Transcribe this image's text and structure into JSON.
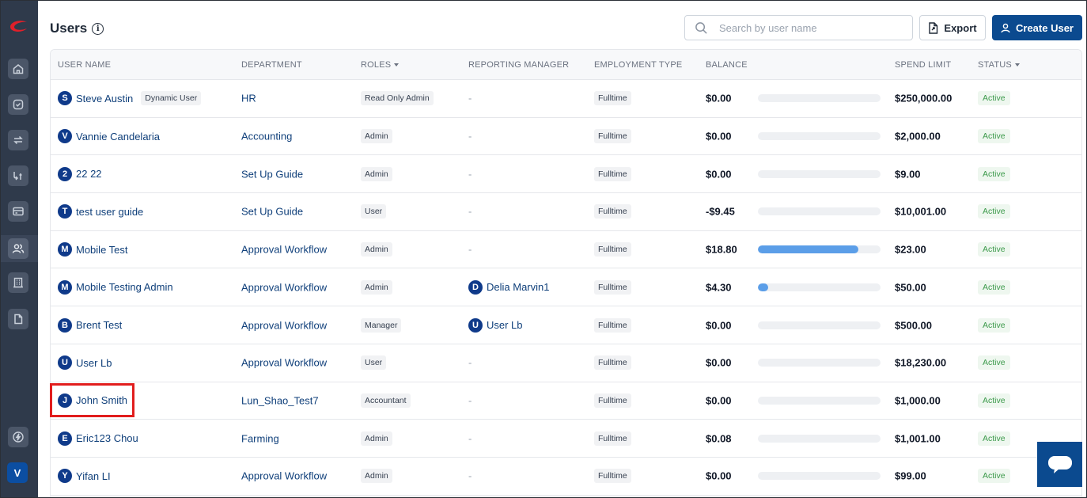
{
  "header": {
    "title": "Users",
    "search_placeholder": "Search by user name",
    "export_label": "Export",
    "create_label": "Create User"
  },
  "sidebar": {
    "items": [
      "home-icon",
      "check-circle-icon",
      "transfer-icon",
      "reimburse-icon",
      "card-icon",
      "users-icon",
      "building-icon",
      "document-icon",
      "lightning-icon"
    ],
    "avatar_initial": "V"
  },
  "table": {
    "headers": {
      "user_name": "USER NAME",
      "department": "DEPARTMENT",
      "roles": "ROLES",
      "reporting_manager": "REPORTING MANAGER",
      "employment_type": "EMPLOYMENT TYPE",
      "balance": "BALANCE",
      "spend_limit": "SPEND LIMIT",
      "status": "STATUS"
    },
    "rows": [
      {
        "initial": "S",
        "name": "Steve Austin",
        "tag": "Dynamic User",
        "department": "HR",
        "role": "Read Only Admin",
        "manager_initial": "",
        "manager": "-",
        "employment": "Fulltime",
        "balance": "$0.00",
        "usage": 0,
        "spend_limit": "$250,000.00",
        "status": "Active"
      },
      {
        "initial": "V",
        "name": "Vannie Candelaria",
        "tag": "",
        "department": "Accounting",
        "role": "Admin",
        "manager_initial": "",
        "manager": "-",
        "employment": "Fulltime",
        "balance": "$0.00",
        "usage": 0,
        "spend_limit": "$2,000.00",
        "status": "Active"
      },
      {
        "initial": "2",
        "name": "22 22",
        "tag": "",
        "department": "Set Up Guide",
        "role": "Admin",
        "manager_initial": "",
        "manager": "-",
        "employment": "Fulltime",
        "balance": "$0.00",
        "usage": 0,
        "spend_limit": "$9.00",
        "status": "Active"
      },
      {
        "initial": "T",
        "name": "test user guide",
        "tag": "",
        "department": "Set Up Guide",
        "role": "User",
        "manager_initial": "",
        "manager": "-",
        "employment": "Fulltime",
        "balance": "-$9.45",
        "usage": 0,
        "spend_limit": "$10,001.00",
        "status": "Active"
      },
      {
        "initial": "M",
        "name": "Mobile Test",
        "tag": "",
        "department": "Approval Workflow",
        "role": "Admin",
        "manager_initial": "",
        "manager": "-",
        "employment": "Fulltime",
        "balance": "$18.80",
        "usage": 0.82,
        "spend_limit": "$23.00",
        "status": "Active"
      },
      {
        "initial": "M",
        "name": "Mobile Testing Admin",
        "tag": "",
        "department": "Approval Workflow",
        "role": "Admin",
        "manager_initial": "D",
        "manager": "Delia Marvin1",
        "employment": "Fulltime",
        "balance": "$4.30",
        "usage": 0.086,
        "spend_limit": "$50.00",
        "status": "Active"
      },
      {
        "initial": "B",
        "name": "Brent Test",
        "tag": "",
        "department": "Approval Workflow",
        "role": "Manager",
        "manager_initial": "U",
        "manager": "User Lb",
        "employment": "Fulltime",
        "balance": "$0.00",
        "usage": 0,
        "spend_limit": "$500.00",
        "status": "Active"
      },
      {
        "initial": "U",
        "name": "User Lb",
        "tag": "",
        "department": "Approval Workflow",
        "role": "User",
        "manager_initial": "",
        "manager": "-",
        "employment": "Fulltime",
        "balance": "$0.00",
        "usage": 0,
        "spend_limit": "$18,230.00",
        "status": "Active"
      },
      {
        "initial": "J",
        "name": "John Smith",
        "tag": "",
        "department": "Lun_Shao_Test7",
        "role": "Accountant",
        "manager_initial": "",
        "manager": "-",
        "employment": "Fulltime",
        "balance": "$0.00",
        "usage": 0,
        "spend_limit": "$1,000.00",
        "status": "Active"
      },
      {
        "initial": "E",
        "name": "Eric123 Chou",
        "tag": "",
        "department": "Farming",
        "role": "Admin",
        "manager_initial": "",
        "manager": "-",
        "employment": "Fulltime",
        "balance": "$0.08",
        "usage": 0,
        "spend_limit": "$1,001.00",
        "status": "Active"
      },
      {
        "initial": "Y",
        "name": "Yifan LI",
        "tag": "",
        "department": "Approval Workflow",
        "role": "Admin",
        "manager_initial": "",
        "manager": "-",
        "employment": "Fulltime",
        "balance": "$0.00",
        "usage": 0,
        "spend_limit": "$99.00",
        "status": "Active"
      }
    ]
  },
  "colors": {
    "sidebar_bg": "#2f3a4b",
    "primary": "#0b4a8f",
    "link": "#0f3f7a",
    "bar_fill": "#5b9ee8",
    "status_green": "#3c9a4b",
    "highlight": "#e11d1d"
  }
}
